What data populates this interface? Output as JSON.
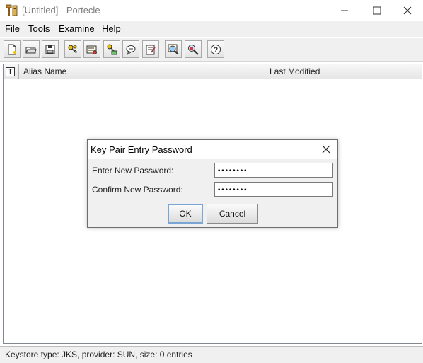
{
  "window": {
    "title": "[Untitled] - Portecle",
    "minimize_glyph": "—",
    "maximize_glyph": "☐",
    "close_glyph": "✕"
  },
  "menu": [
    {
      "mnemonic": "F",
      "rest": "ile"
    },
    {
      "mnemonic": "T",
      "rest": "ools"
    },
    {
      "mnemonic": "E",
      "rest": "xamine"
    },
    {
      "mnemonic": "H",
      "rest": "elp"
    }
  ],
  "toolbar": {
    "icons": [
      "new-keystore-icon",
      "open-keystore-icon",
      "save-keystore-icon",
      "generate-key-pair-icon",
      "import-trusted-certificate-icon",
      "import-key-pair-icon",
      "set-keystore-password-icon",
      "keystore-report-icon",
      "examine-certificate-icon",
      "examine-csr-icon",
      "help-icon"
    ]
  },
  "table": {
    "type_header": "T",
    "columns": [
      "Alias Name",
      "Last Modified"
    ]
  },
  "status": {
    "text": "Keystore type: JKS, provider: SUN, size: 0 entries"
  },
  "dialog": {
    "title": "Key Pair Entry Password",
    "fields": [
      {
        "label": "Enter New Password:",
        "value": "••••••••"
      },
      {
        "label": "Confirm New Password:",
        "value": "••••••••"
      }
    ],
    "ok_label": "OK",
    "cancel_label": "Cancel"
  },
  "colors": {
    "window_bg": "#f0f0f0",
    "focus_border": "#7aa6d6",
    "title_inactive": "#7a7a7a"
  }
}
